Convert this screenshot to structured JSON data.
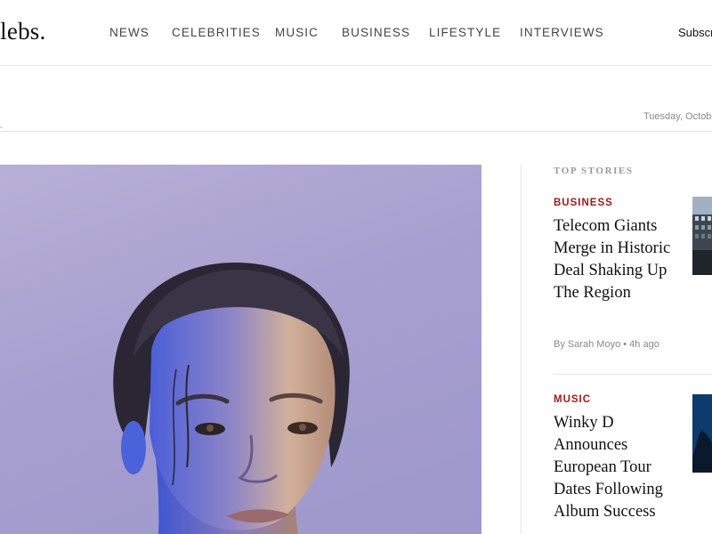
{
  "header": {
    "logo": "elebs.",
    "nav": [
      {
        "label": "NEWS"
      },
      {
        "label": "CELEBRITIES"
      },
      {
        "label": "MUSIC"
      },
      {
        "label": "BUSINESS"
      },
      {
        "label": "LIFESTYLE"
      },
      {
        "label": "INTERVIEWS"
      }
    ],
    "subscribe_label": "Subscri"
  },
  "date_bar": {
    "date_text": "Tuesday, Octobe"
  },
  "sidebar": {
    "title": "TOP STORIES",
    "stories": [
      {
        "category": "BUSINESS",
        "title": "Telecom Giants Merge in Historic Deal Shaking Up The Region",
        "meta": "By Sarah Moyo • 4h ago"
      },
      {
        "category": "MUSIC",
        "title": "Winky D Announces European Tour Dates Following Album Success"
      }
    ]
  },
  "colors": {
    "accent": "#a11a1a",
    "hero_bg": "#a79fcf"
  }
}
